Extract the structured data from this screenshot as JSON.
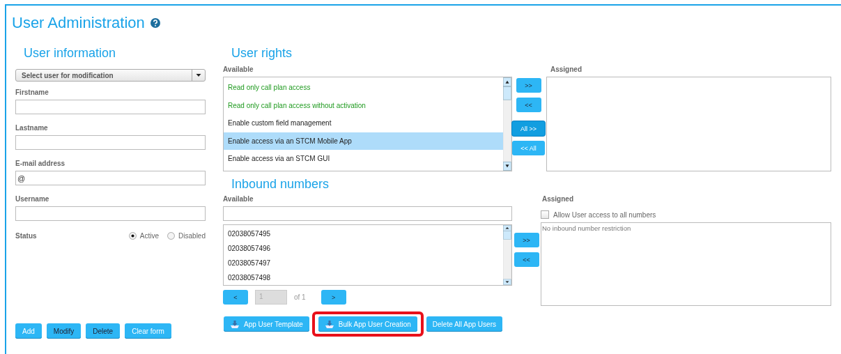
{
  "title": "User Administration",
  "user_info": {
    "heading": "User information",
    "select": {
      "placeholder": "Select user for modification"
    },
    "fields": [
      {
        "label": "Firstname"
      },
      {
        "label": "Lastname"
      },
      {
        "label": "E-mail address",
        "value": "@"
      },
      {
        "label": "Username"
      }
    ],
    "status": {
      "label": "Status",
      "options": [
        {
          "label": "Active",
          "selected": true
        },
        {
          "label": "Disabled",
          "selected": false
        }
      ]
    },
    "buttons": [
      {
        "label": "Add",
        "primary": true
      },
      {
        "label": "Modify",
        "primary": false
      },
      {
        "label": "Delete",
        "primary": false
      },
      {
        "label": "Clear form",
        "primary": true
      }
    ]
  },
  "user_rights": {
    "heading": "User rights",
    "available_label": "Available",
    "assigned_label": "Assigned",
    "available": [
      {
        "label": "Read only call plan access",
        "color": "#1f9a1f",
        "selected": false
      },
      {
        "label": "Read only call plan access without activation",
        "color": "#1f9a1f",
        "selected": false
      },
      {
        "label": "Enable custom field management",
        "color": "#222222",
        "selected": false
      },
      {
        "label": "Enable access via an STCM Mobile App",
        "color": "#222222",
        "selected": true
      },
      {
        "label": "Enable access via an STCM GUI",
        "color": "#222222",
        "selected": false
      }
    ],
    "move_buttons": [
      {
        "label": ">>",
        "focused": false
      },
      {
        "label": "<<",
        "focused": false
      },
      {
        "label": "All >>",
        "focused": true
      },
      {
        "label": "<< All",
        "focused": false
      }
    ]
  },
  "inbound_numbers": {
    "heading": "Inbound numbers",
    "available_label": "Available",
    "assigned_label": "Assigned",
    "available": [
      "02038057495",
      "02038057496",
      "02038057497",
      "02038057498"
    ],
    "move_buttons": [
      ">>",
      "<<"
    ],
    "allow_all": {
      "label": "Allow User access to all numbers",
      "checked": false
    },
    "assigned_placeholder": "No inbound number restriction",
    "pager": {
      "prev": "<",
      "page": "1",
      "of": "of 1",
      "next": ">"
    }
  },
  "app_buttons": [
    {
      "label": "App User Template",
      "icon": true,
      "highlighted": false
    },
    {
      "label": "Bulk App User Creation",
      "icon": true,
      "highlighted": true
    },
    {
      "label": "Delete All App Users",
      "icon": false,
      "highlighted": false
    }
  ]
}
